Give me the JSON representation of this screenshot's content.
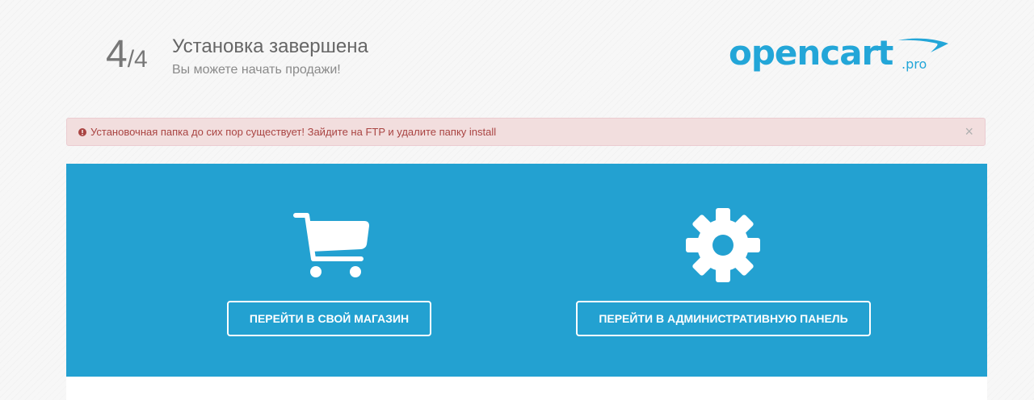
{
  "header": {
    "step_current": "4",
    "step_separator": "/",
    "step_total": "4",
    "title": "Установка завершена",
    "subtitle": "Вы можете начать продажи!"
  },
  "logo": {
    "word": "opencart",
    "suffix": ".pro",
    "color": "#23a6d8"
  },
  "alert": {
    "icon": "exclamation-circle-icon",
    "text": "Установочная папка до сих пор существует! Зайдите на FTP и удалите папку install",
    "close_label": "×",
    "background": "#f2dede",
    "text_color": "#a94442"
  },
  "panel": {
    "background": "#23a1d1",
    "store": {
      "icon": "shopping-cart-icon",
      "button_label": "ПЕРЕЙТИ В СВОЙ МАГАЗИН"
    },
    "admin": {
      "icon": "gear-icon",
      "button_label": "ПЕРЕЙТИ В АДМИНИСТРАТИВНУЮ ПАНЕЛЬ"
    }
  }
}
